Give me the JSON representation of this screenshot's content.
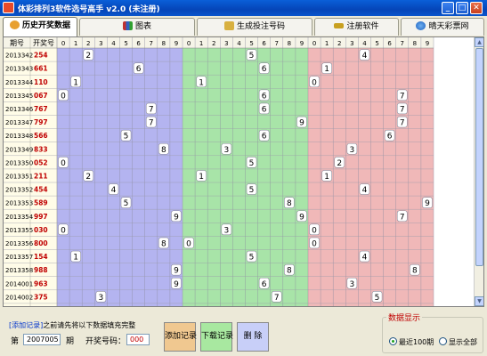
{
  "window": {
    "title": "体彩排列3软件选号高手 v2.0   (未注册)",
    "minimize_glyph": "_",
    "maximize_glyph": "□",
    "close_glyph": "✕"
  },
  "tabs": [
    {
      "label": "历史开奖数据",
      "active": true,
      "icon": "lottery-ball-icon"
    },
    {
      "label": "图表",
      "active": false,
      "icon": "chart-icon"
    },
    {
      "label": "生成投注号码",
      "active": false,
      "icon": "generate-icon"
    },
    {
      "label": "注册软件",
      "active": false,
      "icon": "key-icon"
    },
    {
      "label": "晴天彩票网",
      "active": false,
      "icon": "globe-icon"
    }
  ],
  "table": {
    "col_issue": "期号",
    "col_number": "开奖号",
    "digit_headers": [
      "0",
      "1",
      "2",
      "3",
      "4",
      "5",
      "6",
      "7",
      "8",
      "9"
    ],
    "zone_colors": [
      "#b4b4f0",
      "#a8e4a8",
      "#f0b8b8"
    ],
    "rows": [
      {
        "issue": "2013342",
        "number": "254"
      },
      {
        "issue": "2013343",
        "number": "661"
      },
      {
        "issue": "2013344",
        "number": "110"
      },
      {
        "issue": "2013345",
        "number": "067"
      },
      {
        "issue": "2013346",
        "number": "767"
      },
      {
        "issue": "2013347",
        "number": "797"
      },
      {
        "issue": "2013348",
        "number": "566"
      },
      {
        "issue": "2013349",
        "number": "833"
      },
      {
        "issue": "2013350",
        "number": "052"
      },
      {
        "issue": "2013351",
        "number": "211"
      },
      {
        "issue": "2013352",
        "number": "454"
      },
      {
        "issue": "2013353",
        "number": "589"
      },
      {
        "issue": "2013354",
        "number": "997"
      },
      {
        "issue": "2013355",
        "number": "030"
      },
      {
        "issue": "2013356",
        "number": "800"
      },
      {
        "issue": "2013357",
        "number": "154"
      },
      {
        "issue": "2013358",
        "number": "988"
      },
      {
        "issue": "2014001",
        "number": "963"
      },
      {
        "issue": "2014002",
        "number": "375"
      }
    ]
  },
  "bottom": {
    "hint_bracket": "[添加记录]",
    "hint_text": "之前请先将以下数据填充完整",
    "issue_prefix": "第",
    "issue_value": "2007005",
    "issue_suffix": "期",
    "number_label": "开奖号码：",
    "number_value": "000",
    "add_button": "添加记录",
    "download_button": "下载记录",
    "delete_button": "删 除",
    "add_color": "#f0c890",
    "download_color": "#a8e8a0",
    "delete_color": "#c8cff8",
    "display_group_title": "数据显示",
    "radio_recent": "最近100期",
    "radio_all": "显示全部",
    "radio_selected": "recent"
  }
}
